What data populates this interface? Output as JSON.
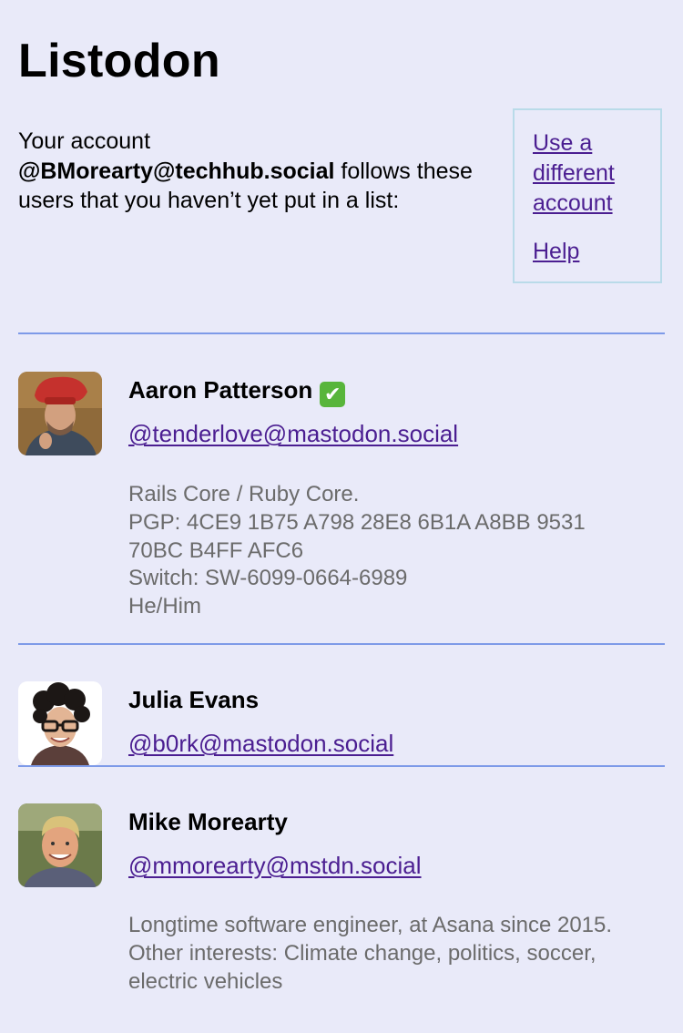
{
  "app": {
    "title": "Listodon"
  },
  "intro": {
    "prefix": "Your account",
    "account": "@BMorearty@techhub.social",
    "suffix": "follows these users that you haven’t yet put in a list:"
  },
  "sidebar": {
    "switch_account_label": "Use a different account",
    "help_label": "Help"
  },
  "users": [
    {
      "name": "Aaron Patterson",
      "verified_emoji": "✔",
      "handle": "@tenderlove@mastodon.social",
      "bio_lines": [
        "Rails Core / Ruby Core.",
        "PGP: 4CE9 1B75 A798 28E8 6B1A A8BB 9531",
        "70BC B4FF AFC6",
        "Switch: SW-6099-0664-6989",
        "He/Him"
      ]
    },
    {
      "name": "Julia Evans",
      "handle": "@b0rk@mastodon.social"
    },
    {
      "name": "Mike Morearty",
      "handle": "@mmorearty@mstdn.social",
      "bio_lines": [
        "Longtime software engineer, at Asana since 2015.",
        "Other interests: Climate change, politics, soccer,",
        "electric vehicles"
      ]
    }
  ],
  "colors": {
    "background": "#e9eaf9",
    "link": "#4b1e91",
    "divider": "#7d9ae8",
    "side_box_border": "#b9dbe9",
    "bio_text": "#6b6b6b",
    "verified": "#58b53b"
  }
}
